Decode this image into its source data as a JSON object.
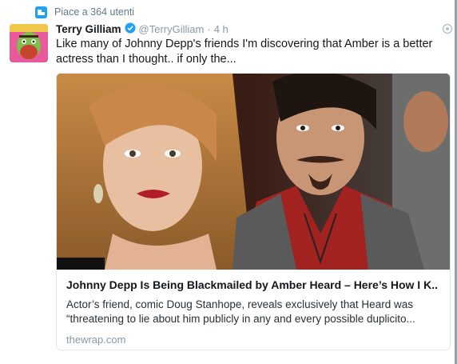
{
  "social_context": {
    "icon": "like-icon",
    "text": "Piace a 364 utenti"
  },
  "tweet": {
    "author_name": "Terry Gilliam",
    "verified": true,
    "handle": "@TerryGilliam",
    "separator": "·",
    "time": "4 h",
    "text": "Like many of Johnny Depp's friends I'm discovering that Amber is a better actress than I thought.. if only the..."
  },
  "card": {
    "image": "photo of a blonde woman with red lipstick and a man with goatee and red shirt",
    "title": "Johnny Depp Is Being Blackmailed by Amber Heard – Here’s How I K..",
    "description": "Actor’s friend, comic Doug Stanhope, reveals exclusively that Heard was “threatening to lie about him publicly in any and every possible duplicito...",
    "domain": "thewrap.com"
  },
  "colors": {
    "accent": "#1da1f2",
    "muted": "#8899a6"
  }
}
